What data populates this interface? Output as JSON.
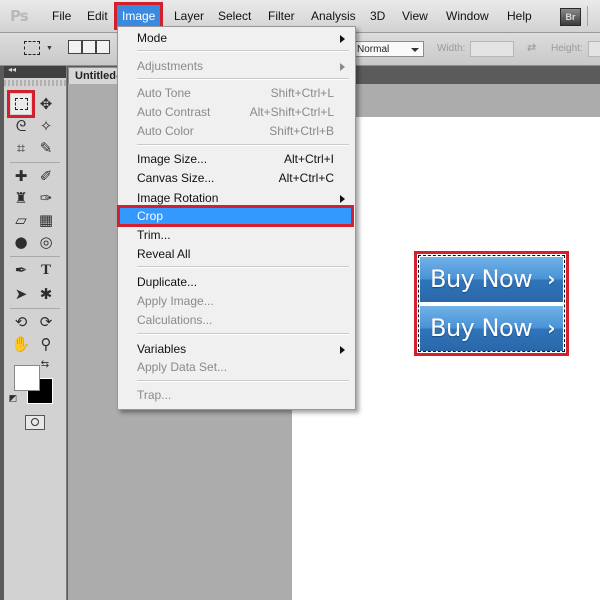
{
  "app": {
    "logo": "Ps",
    "bridge_button": "Br"
  },
  "menubar": {
    "items": [
      "File",
      "Edit",
      "Image",
      "Layer",
      "Select",
      "Filter",
      "Analysis",
      "3D",
      "View",
      "Window",
      "Help"
    ],
    "active": "Image"
  },
  "options": {
    "style_value": "Normal",
    "width_label": "Width:",
    "height_label": "Height:"
  },
  "document": {
    "tab_title": "Untitled-"
  },
  "canvas": {
    "button_text": "Buy Now",
    "chevron": "›"
  },
  "image_menu": {
    "mode": "Mode",
    "adjustments": "Adjustments",
    "auto_tone": {
      "label": "Auto Tone",
      "shortcut": "Shift+Ctrl+L"
    },
    "auto_contrast": {
      "label": "Auto Contrast",
      "shortcut": "Alt+Shift+Ctrl+L"
    },
    "auto_color": {
      "label": "Auto Color",
      "shortcut": "Shift+Ctrl+B"
    },
    "image_size": {
      "label": "Image Size...",
      "shortcut": "Alt+Ctrl+I"
    },
    "canvas_size": {
      "label": "Canvas Size...",
      "shortcut": "Alt+Ctrl+C"
    },
    "image_rotation": "Image Rotation",
    "crop": "Crop",
    "trim": "Trim...",
    "reveal_all": "Reveal All",
    "duplicate": "Duplicate...",
    "apply_image": "Apply Image...",
    "calculations": "Calculations...",
    "variables": "Variables",
    "apply_data_set": "Apply Data Set...",
    "trap": "Trap..."
  },
  "colors": {
    "highlight": "#3399ff",
    "annotation": "#d2212c",
    "button_blue": "#3a83c7"
  },
  "icons": [
    "rect-marquee-icon",
    "move-icon",
    "lasso-icon",
    "magic-wand-icon",
    "crop-icon",
    "eyedropper-icon",
    "healing-icon",
    "brush-icon",
    "stamp-icon",
    "history-brush-icon",
    "eraser-icon",
    "gradient-icon",
    "blur-icon",
    "dodge-icon",
    "pen-icon",
    "type-icon",
    "path-select-icon",
    "shape-icon",
    "3d-rotate-icon",
    "3d-orbit-icon",
    "hand-icon",
    "zoom-icon"
  ]
}
